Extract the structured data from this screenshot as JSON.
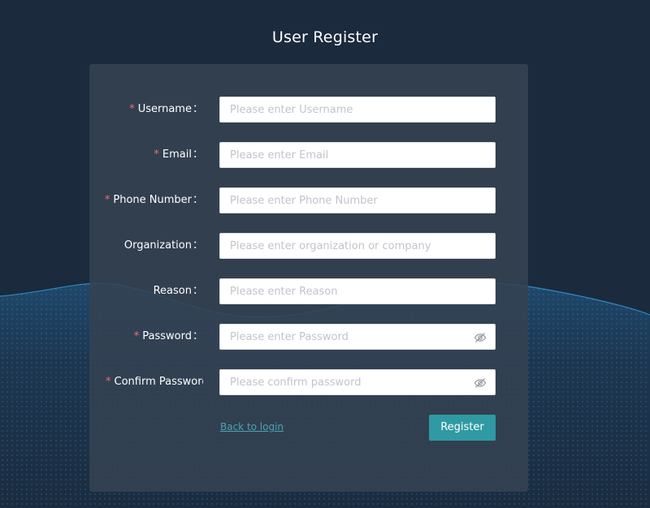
{
  "page": {
    "title": "User Register"
  },
  "form": {
    "fields": [
      {
        "label": "Username",
        "required": true,
        "placeholder": "Please enter Username",
        "type": "text",
        "value": ""
      },
      {
        "label": "Email",
        "required": true,
        "placeholder": "Please enter Email",
        "type": "text",
        "value": ""
      },
      {
        "label": "Phone Number",
        "required": true,
        "placeholder": "Please enter Phone Number",
        "type": "text",
        "value": ""
      },
      {
        "label": "Organization",
        "required": false,
        "placeholder": "Please enter organization or company",
        "type": "text",
        "value": ""
      },
      {
        "label": "Reason",
        "required": false,
        "placeholder": "Please enter Reason",
        "type": "text",
        "value": ""
      },
      {
        "label": "Password",
        "required": true,
        "placeholder": "Please enter Password",
        "type": "password",
        "value": ""
      },
      {
        "label": "Confirm Password",
        "required": true,
        "placeholder": "Please confirm password",
        "type": "password",
        "value": ""
      }
    ],
    "required_mark": "*",
    "colon": "：",
    "back_link_label": "Back to login",
    "register_label": "Register"
  },
  "icons": {
    "password_toggle": "eye-off-icon"
  },
  "colors": {
    "background": "#1b2a3d",
    "panel": "#344252",
    "accent": "#2f9aa3",
    "required": "#f56c6c",
    "link": "#4aa3b2",
    "wave": "#2a8fd6"
  }
}
